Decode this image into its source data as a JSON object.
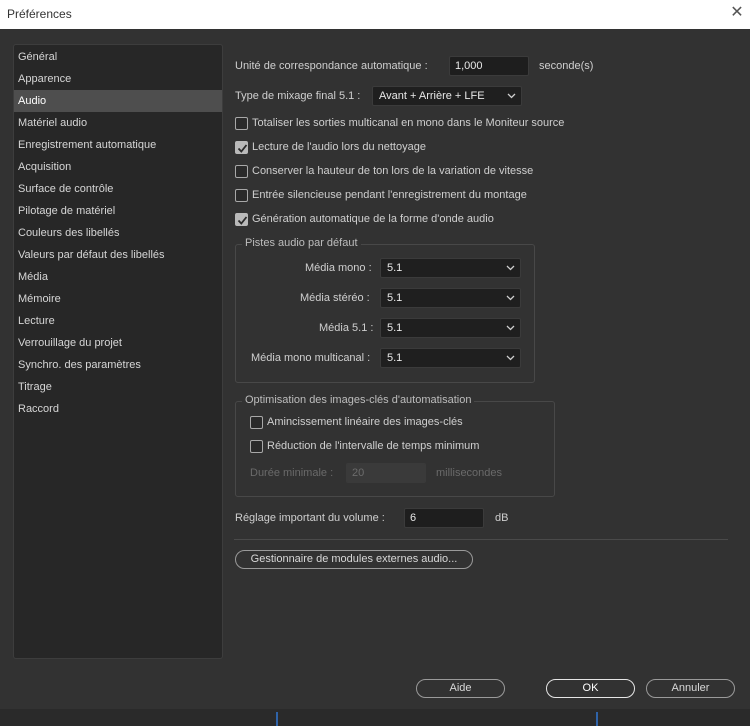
{
  "window": {
    "title": "Préférences",
    "close_symbol": "✕"
  },
  "sidebar": {
    "items": [
      {
        "label": "Général"
      },
      {
        "label": "Apparence"
      },
      {
        "label": "Audio",
        "active": true
      },
      {
        "label": "Matériel audio"
      },
      {
        "label": "Enregistrement automatique"
      },
      {
        "label": "Acquisition"
      },
      {
        "label": "Surface de contrôle"
      },
      {
        "label": "Pilotage de matériel"
      },
      {
        "label": "Couleurs des libellés"
      },
      {
        "label": "Valeurs par défaut des libellés"
      },
      {
        "label": "Média"
      },
      {
        "label": "Mémoire"
      },
      {
        "label": "Lecture"
      },
      {
        "label": "Verrouillage du projet"
      },
      {
        "label": "Synchro. des paramètres"
      },
      {
        "label": "Titrage"
      },
      {
        "label": "Raccord"
      }
    ]
  },
  "audio": {
    "auto_match": {
      "label": "Unité de correspondance automatique :",
      "value": "1,000",
      "unit": "seconde(s)"
    },
    "final_mix": {
      "label": "Type de mixage final 5.1 :",
      "value": "Avant + Arrière + LFE"
    },
    "checkboxes": [
      {
        "label": "Totaliser les sorties multicanal en mono dans le Moniteur source",
        "checked": false
      },
      {
        "label": "Lecture de l'audio lors du nettoyage",
        "checked": true
      },
      {
        "label": "Conserver la hauteur de ton lors de la variation de vitesse",
        "checked": false
      },
      {
        "label": "Entrée silencieuse pendant l'enregistrement du montage",
        "checked": false
      },
      {
        "label": "Génération automatique de la forme d'onde audio",
        "checked": true
      }
    ],
    "default_tracks": {
      "title": "Pistes audio par défaut",
      "rows": [
        {
          "label": "Média mono :",
          "value": "5.1"
        },
        {
          "label": "Média stéréo :",
          "value": "5.1"
        },
        {
          "label": "Média 5.1 :",
          "value": "5.1"
        },
        {
          "label": "Média mono multicanal :",
          "value": "5.1"
        }
      ]
    },
    "keyframe_opt": {
      "title": "Optimisation des images-clés d'automatisation",
      "checkboxes": [
        {
          "label": "Amincissement linéaire des images-clés",
          "checked": false
        },
        {
          "label": "Réduction de l'intervalle de temps minimum",
          "checked": false
        }
      ],
      "min_duration": {
        "label": "Durée minimale :",
        "value": "20",
        "unit": "millisecondes"
      }
    },
    "volume": {
      "label": "Réglage important du volume :",
      "value": "6",
      "unit": "dB"
    },
    "plugin_manager_label": "Gestionnaire de modules externes audio..."
  },
  "footer": {
    "help_label": "Aide",
    "ok_label": "OK",
    "cancel_label": "Annuler"
  },
  "colors": {
    "accent_blue": "#2f63a8",
    "panel_bg": "#323232",
    "sidebar_bg": "#272727"
  }
}
